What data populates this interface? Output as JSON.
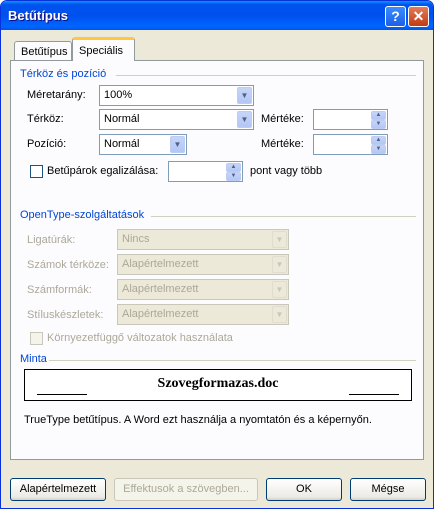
{
  "window": {
    "title": "Betűtípus",
    "help_icon": "?",
    "close_icon": "✕"
  },
  "tabs": [
    {
      "label": "Betűtípus",
      "active": false
    },
    {
      "label": "Speciális",
      "active": true
    }
  ],
  "spacing": {
    "group_title": "Térköz és pozíció",
    "scale_label": "Méretarány:",
    "scale_value": "100%",
    "spacing_label": "Térköz:",
    "spacing_value": "Normál",
    "spacing_by_label": "Mértéke:",
    "spacing_by_value": "",
    "position_label": "Pozíció:",
    "position_value": "Normál",
    "position_by_label": "Mértéke:",
    "position_by_value": "",
    "kerning_label": "Betűpárok egalizálása:",
    "kerning_value": "",
    "kerning_suffix": "pont vagy több"
  },
  "opentype": {
    "group_title": "OpenType-szolgáltatások",
    "ligatures_label": "Ligatúrák:",
    "ligatures_value": "Nincs",
    "number_spacing_label": "Számok térköze:",
    "number_spacing_value": "Alapértelmezett",
    "number_forms_label": "Számformák:",
    "number_forms_value": "Alapértelmezett",
    "stylistic_sets_label": "Stíluskészletek:",
    "stylistic_sets_value": "Alapértelmezett",
    "contextual_label": "Környezetfüggő változatok használata"
  },
  "preview": {
    "group_title": "Minta",
    "sample_text": "Szovegformazas.doc",
    "description": "TrueType betűtípus. A Word ezt használja a nyomtatón és a képernyőn."
  },
  "buttons": {
    "default": "Alapértelmezett",
    "effects": "Effektusok a szövegben...",
    "ok": "OK",
    "cancel": "Mégse"
  },
  "icons": {
    "dropdown_arrow": "▼",
    "spin_up": "▲",
    "spin_down": "▼"
  }
}
